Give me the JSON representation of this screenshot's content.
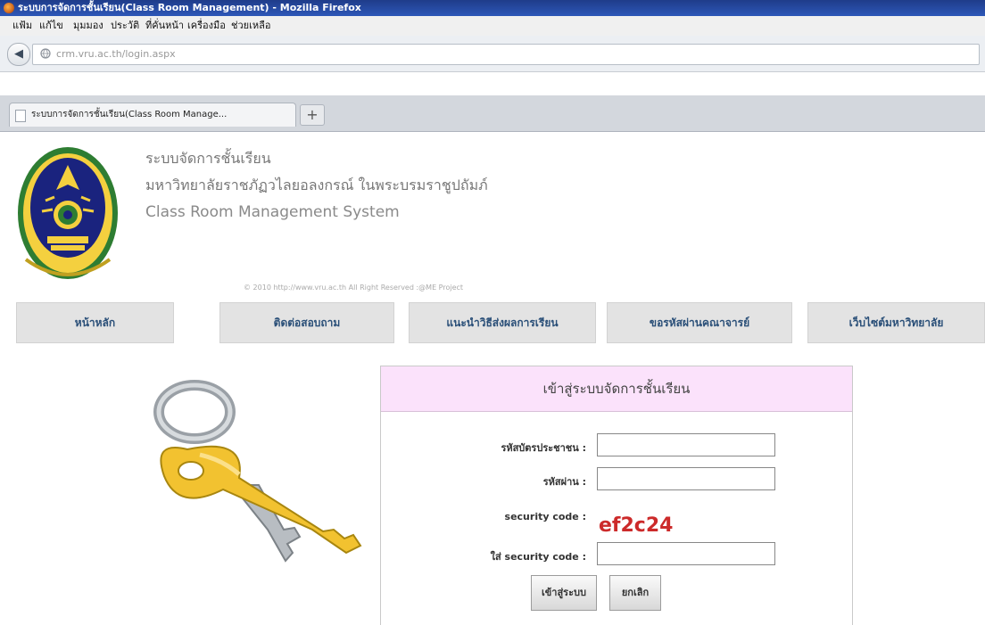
{
  "window": {
    "title": "ระบบการจัดการชั้นเรียน(Class Room Management) - Mozilla Firefox"
  },
  "menu": [
    "แฟ้ม",
    "แก้ไข",
    "มุมมอง",
    "ประวัติ",
    "ที่คั่นหน้า",
    "เครื่องมือ",
    "ช่วยเหลือ"
  ],
  "browser": {
    "url": "crm.vru.ac.th/login.aspx",
    "tab_title": "ระบบการจัดการชั้นเรียน(Class Room Manage...",
    "new_tab": "+"
  },
  "header": {
    "line1": "ระบบจัดการชั้นเรียน",
    "line2": "มหาวิทยาลัยราชภัฏวไลยอลงกรณ์ ในพระบรมราชูปถัมภ์",
    "line3": "Class Room Management System",
    "copyright": "© 2010 http://www.vru.ac.th All Right Reserved :@ME Project"
  },
  "nav": [
    "หน้าหลัก",
    "ติดต่อสอบถาม",
    "แนะนำวิธีส่งผลการเรียน",
    "ขอรหัสผ่านคณาจารย์",
    "เว็บไซต์มหาวิทยาลัย"
  ],
  "login": {
    "heading": "เข้าสู่ระบบจัดการชั้นเรียน",
    "id_label": "รหัสบัตรประชาชน :",
    "id_value": "",
    "password_label": "รหัสผ่าน :",
    "password_value": "",
    "security_label": "security code :",
    "security_code": "ef2c24",
    "enter_code_label": "ใส่ security code :",
    "enter_code_value": "",
    "submit_label": "เข้าสู่ระบบ",
    "cancel_label": "ยกเลิก"
  },
  "colors": {
    "titlebar": "#2d57b8",
    "panel_header": "#fbe2fb",
    "nav_text": "#2a4f78",
    "security_code": "#cc2a2a"
  }
}
